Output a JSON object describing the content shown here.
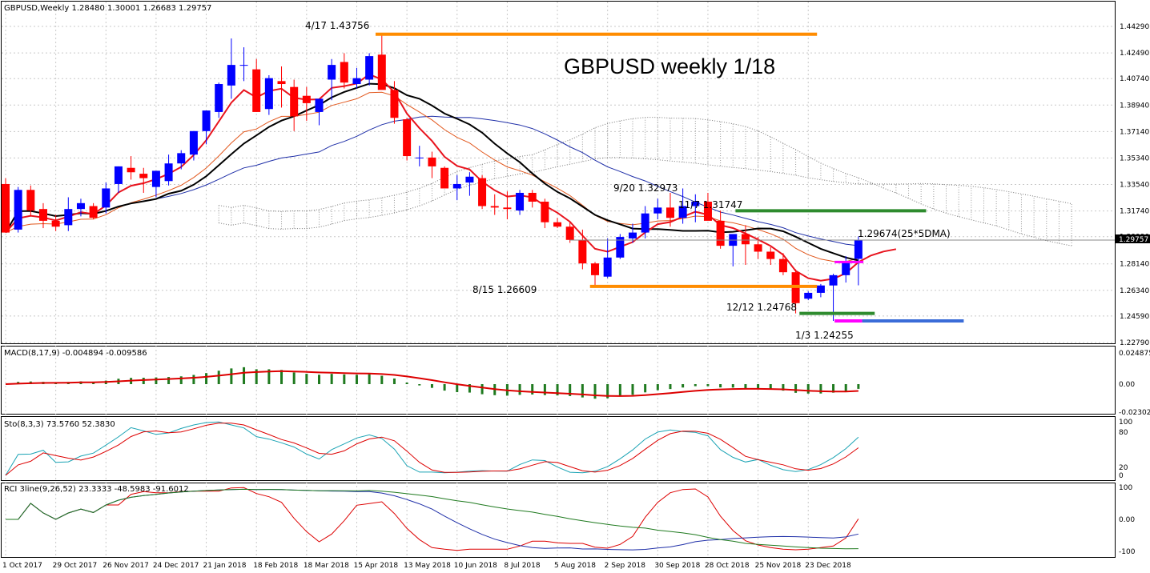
{
  "chart_data": [
    {
      "type": "candlestick",
      "title": "GBPUSD,Weekly  1.28480 1.30001 1.26683 1.29757",
      "headline": "GBPUSD weekly 1/18",
      "current_price": "1.29757",
      "price_axis_labels": [
        "1.44290",
        "1.42490",
        "1.40740",
        "1.38940",
        "1.37140",
        "1.35340",
        "1.33540",
        "1.31740",
        "1.29990",
        "1.28140",
        "1.26340",
        "1.24590",
        "1.22790"
      ],
      "ylim": [
        1.2279,
        1.4609
      ],
      "date_labels": [
        "1 Oct 2017",
        "29 Oct 2017",
        "26 Nov 2017",
        "24 Dec 2017",
        "21 Jan 2018",
        "18 Feb 2018",
        "18 Mar 2018",
        "15 Apr 2018",
        "13 May 2018",
        "10 Jun 2018",
        "8 Jul 2018",
        "5 Aug 2018",
        "2 Sep 2018",
        "30 Sep 2018",
        "28 Oct 2018",
        "25 Nov 2018",
        "23 Dec 2018"
      ],
      "candles": [
        [
          1.3357,
          1.3397,
          1.3027,
          1.3027
        ],
        [
          1.3047,
          1.3337,
          1.3027,
          1.3317
        ],
        [
          1.3317,
          1.3347,
          1.3137,
          1.3177
        ],
        [
          1.3187,
          1.3227,
          1.3057,
          1.3107
        ],
        [
          1.3107,
          1.3147,
          1.3037,
          1.3067
        ],
        [
          1.3077,
          1.3267,
          1.3037,
          1.3187
        ],
        [
          1.3187,
          1.3257,
          1.3137,
          1.3227
        ],
        [
          1.3207,
          1.3227,
          1.3117,
          1.3127
        ],
        [
          1.3197,
          1.3367,
          1.3157,
          1.3327
        ],
        [
          1.3357,
          1.3477,
          1.3297,
          1.3477
        ],
        [
          1.3467,
          1.3547,
          1.3387,
          1.3437
        ],
        [
          1.3427,
          1.3467,
          1.3297,
          1.3397
        ],
        [
          1.3337,
          1.3437,
          1.3267,
          1.3447
        ],
        [
          1.3377,
          1.3557,
          1.3347,
          1.3497
        ],
        [
          1.3497,
          1.3587,
          1.3457,
          1.3567
        ],
        [
          1.3557,
          1.3717,
          1.3517,
          1.3717
        ],
        [
          1.3717,
          1.3857,
          1.3627,
          1.3857
        ],
        [
          1.3847,
          1.4047,
          1.3807,
          1.4037
        ],
        [
          1.4027,
          1.4347,
          1.3937,
          1.4167
        ],
        [
          1.4167,
          1.4287,
          1.4057,
          1.4167
        ],
        [
          1.4137,
          1.4207,
          1.3847,
          1.3847
        ],
        [
          1.3867,
          1.4097,
          1.3827,
          1.4077
        ],
        [
          1.4057,
          1.4157,
          1.3877,
          1.4037
        ],
        [
          1.4017,
          1.4067,
          1.3717,
          1.3817
        ],
        [
          1.3957,
          1.4017,
          1.3787,
          1.3907
        ],
        [
          1.3847,
          1.3937,
          1.3757,
          1.3937
        ],
        [
          1.4067,
          1.4207,
          1.3927,
          1.4167
        ],
        [
          1.4187,
          1.4247,
          1.4007,
          1.4047
        ],
        [
          1.4037,
          1.4147,
          1.4007,
          1.4077
        ],
        [
          1.4067,
          1.4247,
          1.4027,
          1.4227
        ],
        [
          1.4237,
          1.4376,
          1.4087,
          1.3997
        ],
        [
          1.3997,
          1.4057,
          1.3767,
          1.3807
        ],
        [
          1.3797,
          1.3807,
          1.3517,
          1.3547
        ],
        [
          1.3537,
          1.3617,
          1.3477,
          1.3537
        ],
        [
          1.3537,
          1.3577,
          1.3397,
          1.3477
        ],
        [
          1.3467,
          1.3477,
          1.3327,
          1.3327
        ],
        [
          1.3327,
          1.3417,
          1.3247,
          1.3357
        ],
        [
          1.3367,
          1.3437,
          1.3277,
          1.3407
        ],
        [
          1.3397,
          1.3417,
          1.3187,
          1.3207
        ],
        [
          1.3207,
          1.3287,
          1.3147,
          1.3197
        ],
        [
          1.3197,
          1.3307,
          1.3117,
          1.3187
        ],
        [
          1.3177,
          1.3317,
          1.3147,
          1.3297
        ],
        [
          1.3297,
          1.3317,
          1.3197,
          1.3237
        ],
        [
          1.3237,
          1.3257,
          1.3057,
          1.3097
        ],
        [
          1.3097,
          1.3127,
          1.3057,
          1.3067
        ],
        [
          1.3067,
          1.3097,
          1.2957,
          1.2977
        ],
        [
          1.2977,
          1.3047,
          1.2777,
          1.2817
        ],
        [
          1.2817,
          1.2827,
          1.2661,
          1.2737
        ],
        [
          1.2727,
          1.2987,
          1.2717,
          1.2857
        ],
        [
          1.2857,
          1.3017,
          1.2847,
          1.2997
        ],
        [
          1.2987,
          1.3087,
          1.2957,
          1.3027
        ],
        [
          1.3027,
          1.3207,
          1.2987,
          1.3157
        ],
        [
          1.3157,
          1.3257,
          1.3117,
          1.3197
        ],
        [
          1.3197,
          1.3297,
          1.3067,
          1.3127
        ],
        [
          1.3127,
          1.3327,
          1.3087,
          1.3207
        ],
        [
          1.3207,
          1.3287,
          1.3097,
          1.3237
        ],
        [
          1.3237,
          1.3297,
          1.3147,
          1.3107
        ],
        [
          1.3107,
          1.3177,
          1.2917,
          1.2937
        ],
        [
          1.2937,
          1.3007,
          1.2797,
          1.3017
        ],
        [
          1.3017,
          1.3077,
          1.2807,
          1.2947
        ],
        [
          1.2947,
          1.2997,
          1.2847,
          1.2897
        ],
        [
          1.2897,
          1.2927,
          1.2807,
          1.2847
        ],
        [
          1.2847,
          1.2887,
          1.2737,
          1.2757
        ],
        [
          1.2757,
          1.2777,
          1.2477,
          1.2547
        ],
        [
          1.2577,
          1.2627,
          1.2567,
          1.2617
        ],
        [
          1.2617,
          1.2677,
          1.2587,
          1.2667
        ],
        [
          1.2667,
          1.2747,
          1.2426,
          1.2737
        ],
        [
          1.2737,
          1.2867,
          1.2687,
          1.2827
        ],
        [
          1.2848,
          1.3,
          1.2668,
          1.2976
        ]
      ],
      "annotations": [
        {
          "text": "4/17 1.43756",
          "level": 1.4376
        },
        {
          "text": "9/20 1.32973",
          "level": 1.3297
        },
        {
          "text": "11/7 1.31747",
          "level": 1.3175
        },
        {
          "text": "1.29674(25*5DMA)",
          "level": 1.2967
        },
        {
          "text": "8/15 1.26609",
          "level": 1.2661
        },
        {
          "text": "12/12 1.24768",
          "level": 1.2477
        },
        {
          "text": "1/3 1.24255",
          "level": 1.2426
        }
      ],
      "colors": {
        "up": "#0000ff",
        "down": "#ff0000",
        "orange": "#ff8c00",
        "green": "#2e8b2e",
        "magenta": "#ff00ff",
        "blue_line": "#3a6cd8"
      }
    },
    {
      "type": "bar",
      "title": "MACD(8,17,9) -0.004894 -0.009586",
      "ticks": [
        "0.024875",
        "0.00",
        "-0.023026"
      ],
      "ylim": [
        -0.023026,
        0.024875
      ]
    },
    {
      "type": "line",
      "title": "Sto(8,3,3) 73.5760 52.3830",
      "ticks": [
        "100",
        "80",
        "20",
        "0"
      ],
      "ylim": [
        0,
        100
      ]
    },
    {
      "type": "line",
      "title": "RCI 3line(9,26,52) 23.3333 -48.5983 -91.6012",
      "ticks": [
        "100",
        "0.00",
        "-100"
      ],
      "ylim": [
        -100,
        100
      ]
    }
  ]
}
